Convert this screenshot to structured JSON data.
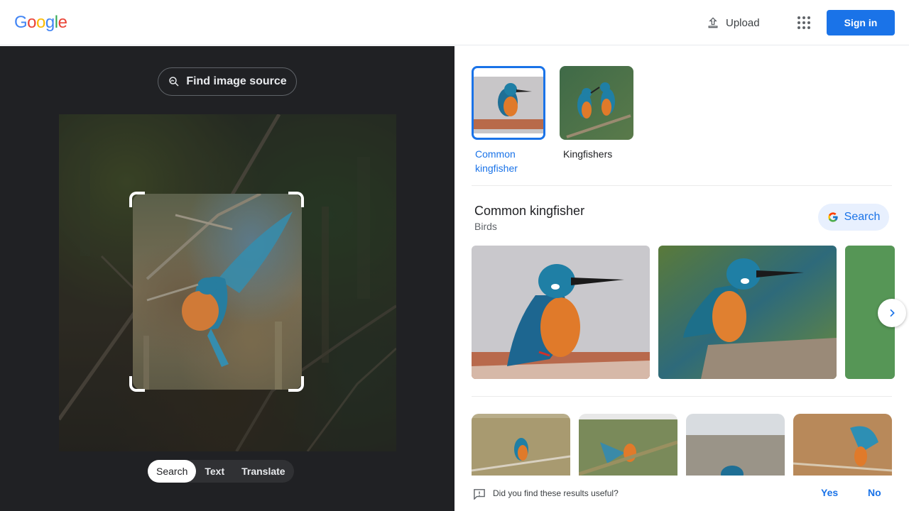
{
  "header": {
    "logo_letters": [
      {
        "ch": "G",
        "color": "#4285F4"
      },
      {
        "ch": "o",
        "color": "#EA4335"
      },
      {
        "ch": "o",
        "color": "#FBBC05"
      },
      {
        "ch": "g",
        "color": "#4285F4"
      },
      {
        "ch": "l",
        "color": "#34A853"
      },
      {
        "ch": "e",
        "color": "#EA4335"
      }
    ],
    "upload_label": "Upload",
    "upload_icon": "upload-icon",
    "apps_icon": "apps-grid-icon",
    "signin_label": "Sign in"
  },
  "left_panel": {
    "find_source_label": "Find image source",
    "find_source_icon": "image-search-icon",
    "modes": [
      {
        "label": "Search",
        "active": true
      },
      {
        "label": "Text",
        "active": false
      },
      {
        "label": "Translate",
        "active": false
      }
    ]
  },
  "results": {
    "chips": [
      {
        "label": "Common kingfisher",
        "selected": true
      },
      {
        "label": "Kingfishers",
        "selected": false
      }
    ],
    "knowledge": {
      "title": "Common kingfisher",
      "subtitle": "Birds",
      "search_label": "Search"
    },
    "feedback": {
      "question": "Did you find these results useful?",
      "yes": "Yes",
      "no": "No"
    }
  },
  "colors": {
    "accent": "#1a73e8",
    "dark_panel": "#202124",
    "kingfisher_blue": "#1f7fa5",
    "kingfisher_orange": "#e07a2a"
  }
}
